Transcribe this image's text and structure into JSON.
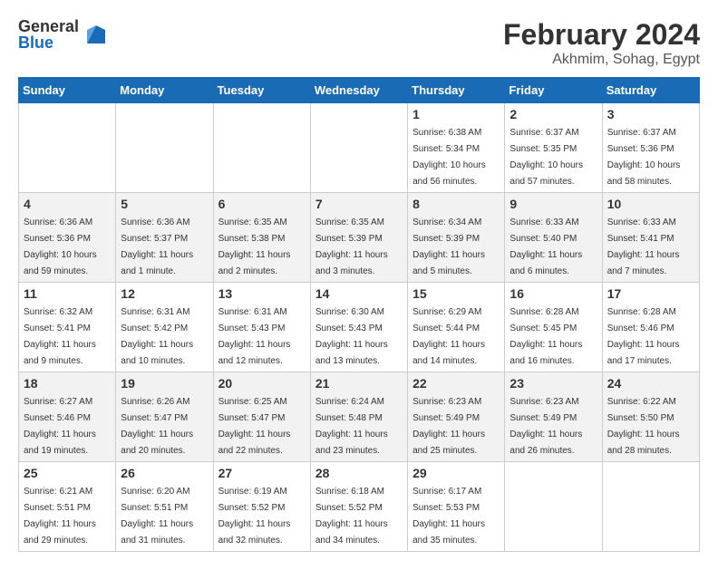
{
  "header": {
    "logo_general": "General",
    "logo_blue": "Blue",
    "month_year": "February 2024",
    "location": "Akhmim, Sohag, Egypt"
  },
  "days_of_week": [
    "Sunday",
    "Monday",
    "Tuesday",
    "Wednesday",
    "Thursday",
    "Friday",
    "Saturday"
  ],
  "weeks": [
    [
      {
        "day": "",
        "info": ""
      },
      {
        "day": "",
        "info": ""
      },
      {
        "day": "",
        "info": ""
      },
      {
        "day": "",
        "info": ""
      },
      {
        "day": "1",
        "info": "Sunrise: 6:38 AM\nSunset: 5:34 PM\nDaylight: 10 hours and 56 minutes."
      },
      {
        "day": "2",
        "info": "Sunrise: 6:37 AM\nSunset: 5:35 PM\nDaylight: 10 hours and 57 minutes."
      },
      {
        "day": "3",
        "info": "Sunrise: 6:37 AM\nSunset: 5:36 PM\nDaylight: 10 hours and 58 minutes."
      }
    ],
    [
      {
        "day": "4",
        "info": "Sunrise: 6:36 AM\nSunset: 5:36 PM\nDaylight: 10 hours and 59 minutes."
      },
      {
        "day": "5",
        "info": "Sunrise: 6:36 AM\nSunset: 5:37 PM\nDaylight: 11 hours and 1 minute."
      },
      {
        "day": "6",
        "info": "Sunrise: 6:35 AM\nSunset: 5:38 PM\nDaylight: 11 hours and 2 minutes."
      },
      {
        "day": "7",
        "info": "Sunrise: 6:35 AM\nSunset: 5:39 PM\nDaylight: 11 hours and 3 minutes."
      },
      {
        "day": "8",
        "info": "Sunrise: 6:34 AM\nSunset: 5:39 PM\nDaylight: 11 hours and 5 minutes."
      },
      {
        "day": "9",
        "info": "Sunrise: 6:33 AM\nSunset: 5:40 PM\nDaylight: 11 hours and 6 minutes."
      },
      {
        "day": "10",
        "info": "Sunrise: 6:33 AM\nSunset: 5:41 PM\nDaylight: 11 hours and 7 minutes."
      }
    ],
    [
      {
        "day": "11",
        "info": "Sunrise: 6:32 AM\nSunset: 5:41 PM\nDaylight: 11 hours and 9 minutes."
      },
      {
        "day": "12",
        "info": "Sunrise: 6:31 AM\nSunset: 5:42 PM\nDaylight: 11 hours and 10 minutes."
      },
      {
        "day": "13",
        "info": "Sunrise: 6:31 AM\nSunset: 5:43 PM\nDaylight: 11 hours and 12 minutes."
      },
      {
        "day": "14",
        "info": "Sunrise: 6:30 AM\nSunset: 5:43 PM\nDaylight: 11 hours and 13 minutes."
      },
      {
        "day": "15",
        "info": "Sunrise: 6:29 AM\nSunset: 5:44 PM\nDaylight: 11 hours and 14 minutes."
      },
      {
        "day": "16",
        "info": "Sunrise: 6:28 AM\nSunset: 5:45 PM\nDaylight: 11 hours and 16 minutes."
      },
      {
        "day": "17",
        "info": "Sunrise: 6:28 AM\nSunset: 5:46 PM\nDaylight: 11 hours and 17 minutes."
      }
    ],
    [
      {
        "day": "18",
        "info": "Sunrise: 6:27 AM\nSunset: 5:46 PM\nDaylight: 11 hours and 19 minutes."
      },
      {
        "day": "19",
        "info": "Sunrise: 6:26 AM\nSunset: 5:47 PM\nDaylight: 11 hours and 20 minutes."
      },
      {
        "day": "20",
        "info": "Sunrise: 6:25 AM\nSunset: 5:47 PM\nDaylight: 11 hours and 22 minutes."
      },
      {
        "day": "21",
        "info": "Sunrise: 6:24 AM\nSunset: 5:48 PM\nDaylight: 11 hours and 23 minutes."
      },
      {
        "day": "22",
        "info": "Sunrise: 6:23 AM\nSunset: 5:49 PM\nDaylight: 11 hours and 25 minutes."
      },
      {
        "day": "23",
        "info": "Sunrise: 6:23 AM\nSunset: 5:49 PM\nDaylight: 11 hours and 26 minutes."
      },
      {
        "day": "24",
        "info": "Sunrise: 6:22 AM\nSunset: 5:50 PM\nDaylight: 11 hours and 28 minutes."
      }
    ],
    [
      {
        "day": "25",
        "info": "Sunrise: 6:21 AM\nSunset: 5:51 PM\nDaylight: 11 hours and 29 minutes."
      },
      {
        "day": "26",
        "info": "Sunrise: 6:20 AM\nSunset: 5:51 PM\nDaylight: 11 hours and 31 minutes."
      },
      {
        "day": "27",
        "info": "Sunrise: 6:19 AM\nSunset: 5:52 PM\nDaylight: 11 hours and 32 minutes."
      },
      {
        "day": "28",
        "info": "Sunrise: 6:18 AM\nSunset: 5:52 PM\nDaylight: 11 hours and 34 minutes."
      },
      {
        "day": "29",
        "info": "Sunrise: 6:17 AM\nSunset: 5:53 PM\nDaylight: 11 hours and 35 minutes."
      },
      {
        "day": "",
        "info": ""
      },
      {
        "day": "",
        "info": ""
      }
    ]
  ]
}
